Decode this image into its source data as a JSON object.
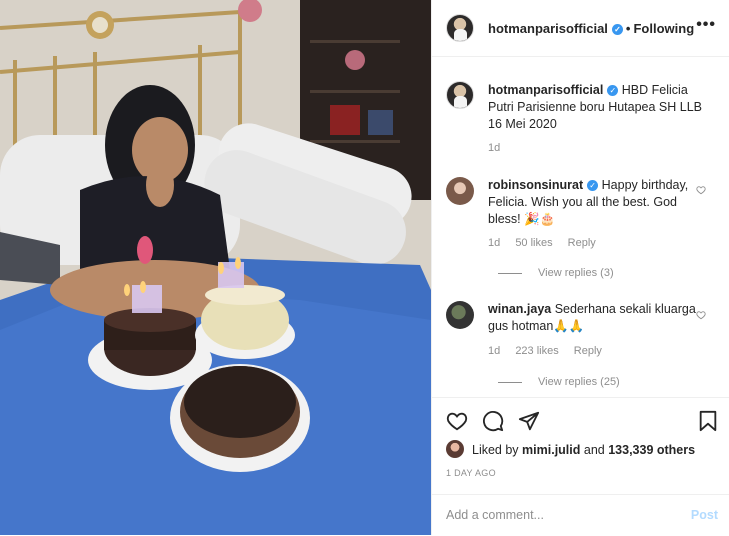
{
  "post": {
    "author": "hotmanparisofficial",
    "separator": "•",
    "follow_state": "Following",
    "more_icon": "more-horizontal-icon",
    "photo_alt": "birthday-photo"
  },
  "caption": {
    "username": "hotmanparisofficial",
    "text": "HBD Felicia Putri Parisienne boru Hutapea SH LLB 16 Mei 2020",
    "age": "1d"
  },
  "comments": [
    {
      "username": "robinsonsinurat",
      "verified": true,
      "text": "Happy birthday, Felicia. Wish you all the best. God bless! 🎉🎂",
      "age": "1d",
      "likes": "50 likes",
      "reply": "Reply",
      "view_replies": "View replies (3)"
    },
    {
      "username": "winan.jaya",
      "verified": false,
      "text": "Sederhana sekali kluarga gus hotman🙏🙏",
      "age": "1d",
      "likes": "223 likes",
      "reply": "Reply",
      "view_replies": "View replies (25)"
    }
  ],
  "likes": {
    "prefix": "Liked by",
    "user": "mimi.julid",
    "conj": "and",
    "others": "133,339 others"
  },
  "time_ago": "1 DAY AGO",
  "add_comment": {
    "placeholder": "Add a comment...",
    "post_label": "Post"
  },
  "colors": {
    "verified": "#3897f0",
    "muted": "#8e8e8e",
    "post_disabled": "#b3dbff"
  }
}
